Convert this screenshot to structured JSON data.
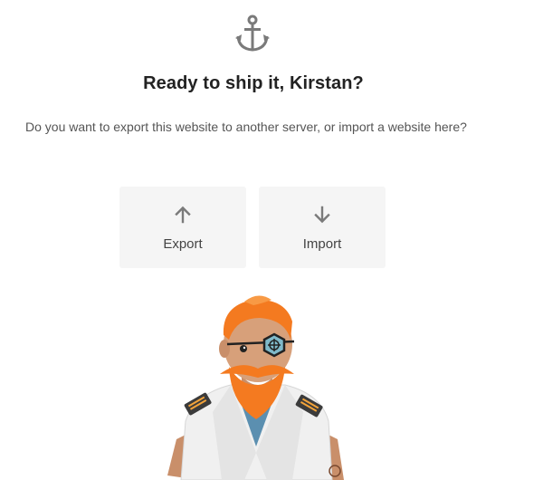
{
  "header": {
    "icon": "anchor-icon",
    "title": "Ready to ship it, Kirstan?",
    "subtitle": "Do you want to export this website to another server, or import a website here?"
  },
  "actions": [
    {
      "label": "Export",
      "icon": "arrow-up-icon"
    },
    {
      "label": "Import",
      "icon": "arrow-down-icon"
    }
  ],
  "illustration": {
    "name": "sailor-captain-mascot",
    "colors": {
      "hair": "#f47a20",
      "skin": "#d7a07a",
      "uniform": "#f2f2f2",
      "shirt": "#5b8fb0",
      "eyepatch": "#7fb9c9"
    }
  },
  "colors": {
    "icon_gray": "#7a7a7a",
    "card_bg": "#f5f5f5",
    "title": "#222222",
    "text": "#555555"
  }
}
